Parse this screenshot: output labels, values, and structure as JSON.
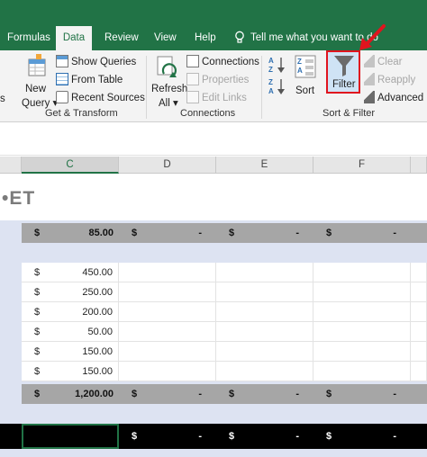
{
  "tabs": [
    "Formulas",
    "Data",
    "Review",
    "View",
    "Help"
  ],
  "tell_me": "Tell me what you want to do",
  "ribbon": {
    "get_transform": {
      "new_query": "New",
      "new_query_sub": "Query ▾",
      "show_queries": "Show Queries",
      "from_table": "From Table",
      "recent_sources": "Recent Sources",
      "label": "Get & Transform"
    },
    "connections": {
      "refresh": "Refresh",
      "refresh_sub": "All ▾",
      "connections": "Connections",
      "properties": "Properties",
      "edit_links": "Edit Links",
      "label": "Connections"
    },
    "sort_filter": {
      "sort": "Sort",
      "filter": "Filter",
      "clear": "Clear",
      "reapply": "Reapply",
      "advanced": "Advanced",
      "label": "Sort & Filter"
    },
    "partial_left": "s"
  },
  "columns": [
    "C",
    "D",
    "E",
    "F"
  ],
  "sheet": {
    "title": "•ET",
    "currency": "$",
    "dash": "-",
    "top_total": "85.00",
    "values": [
      "450.00",
      "250.00",
      "200.00",
      "50.00",
      "150.00",
      "150.00"
    ],
    "bottom_total": "1,200.00"
  },
  "colors": {
    "accent": "#217346",
    "highlight": "#e0141e",
    "total_row": "#a6a6a6",
    "sheet_bg": "#dde3f2"
  }
}
